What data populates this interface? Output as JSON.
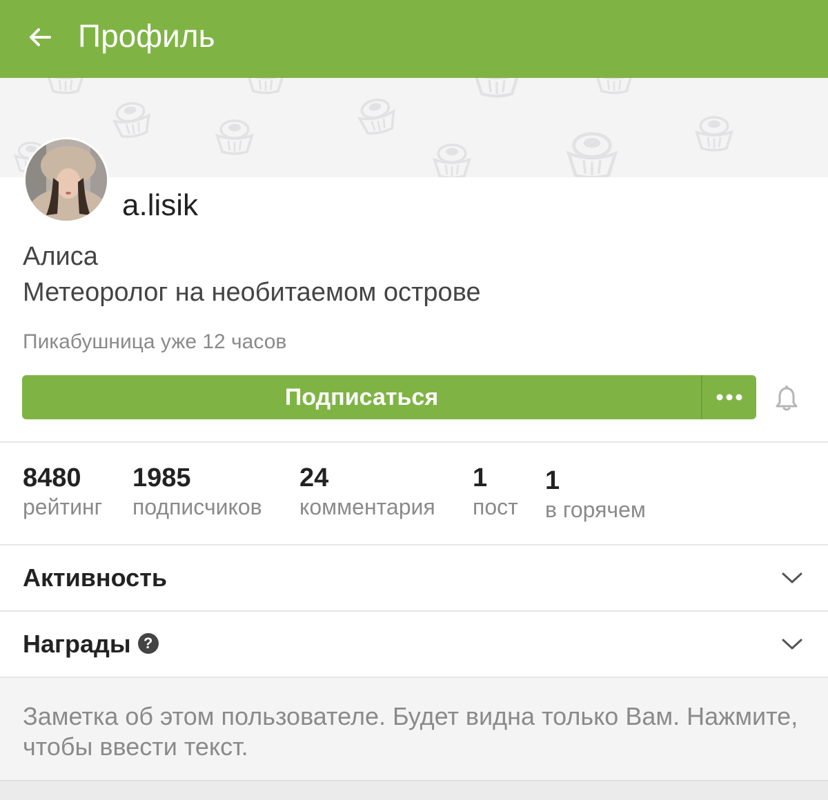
{
  "colors": {
    "brand": "#7fb445",
    "cover_bg": "#f4f4f5",
    "muted_text": "#8a8a8a"
  },
  "appbar": {
    "title": "Профиль",
    "back_icon": "arrow-left-icon"
  },
  "profile": {
    "username": "a.lisik",
    "real_name": "Алиса",
    "bio": "Метеоролог на необитаемом острове",
    "member_since": "Пикабушница уже 12 часов"
  },
  "actions": {
    "subscribe_label": "Подписаться",
    "more_icon": "more-dots-icon",
    "bell_icon": "bell-icon"
  },
  "stats": [
    {
      "value": "8480",
      "label": "рейтинг"
    },
    {
      "value": "1985",
      "label": "подписчиков"
    },
    {
      "value": "24",
      "label": "комментария"
    },
    {
      "value": "1",
      "label": "пост"
    },
    {
      "value": "1",
      "label": "в горячем"
    }
  ],
  "sections": {
    "activity": {
      "title": "Активность",
      "icon": "chevron-down-icon"
    },
    "awards": {
      "title": "Награды",
      "help_glyph": "?",
      "icon": "chevron-down-icon"
    }
  },
  "note": {
    "text": "Заметка об этом пользователе. Будет видна только Вам. Нажмите, чтобы ввести текст."
  }
}
